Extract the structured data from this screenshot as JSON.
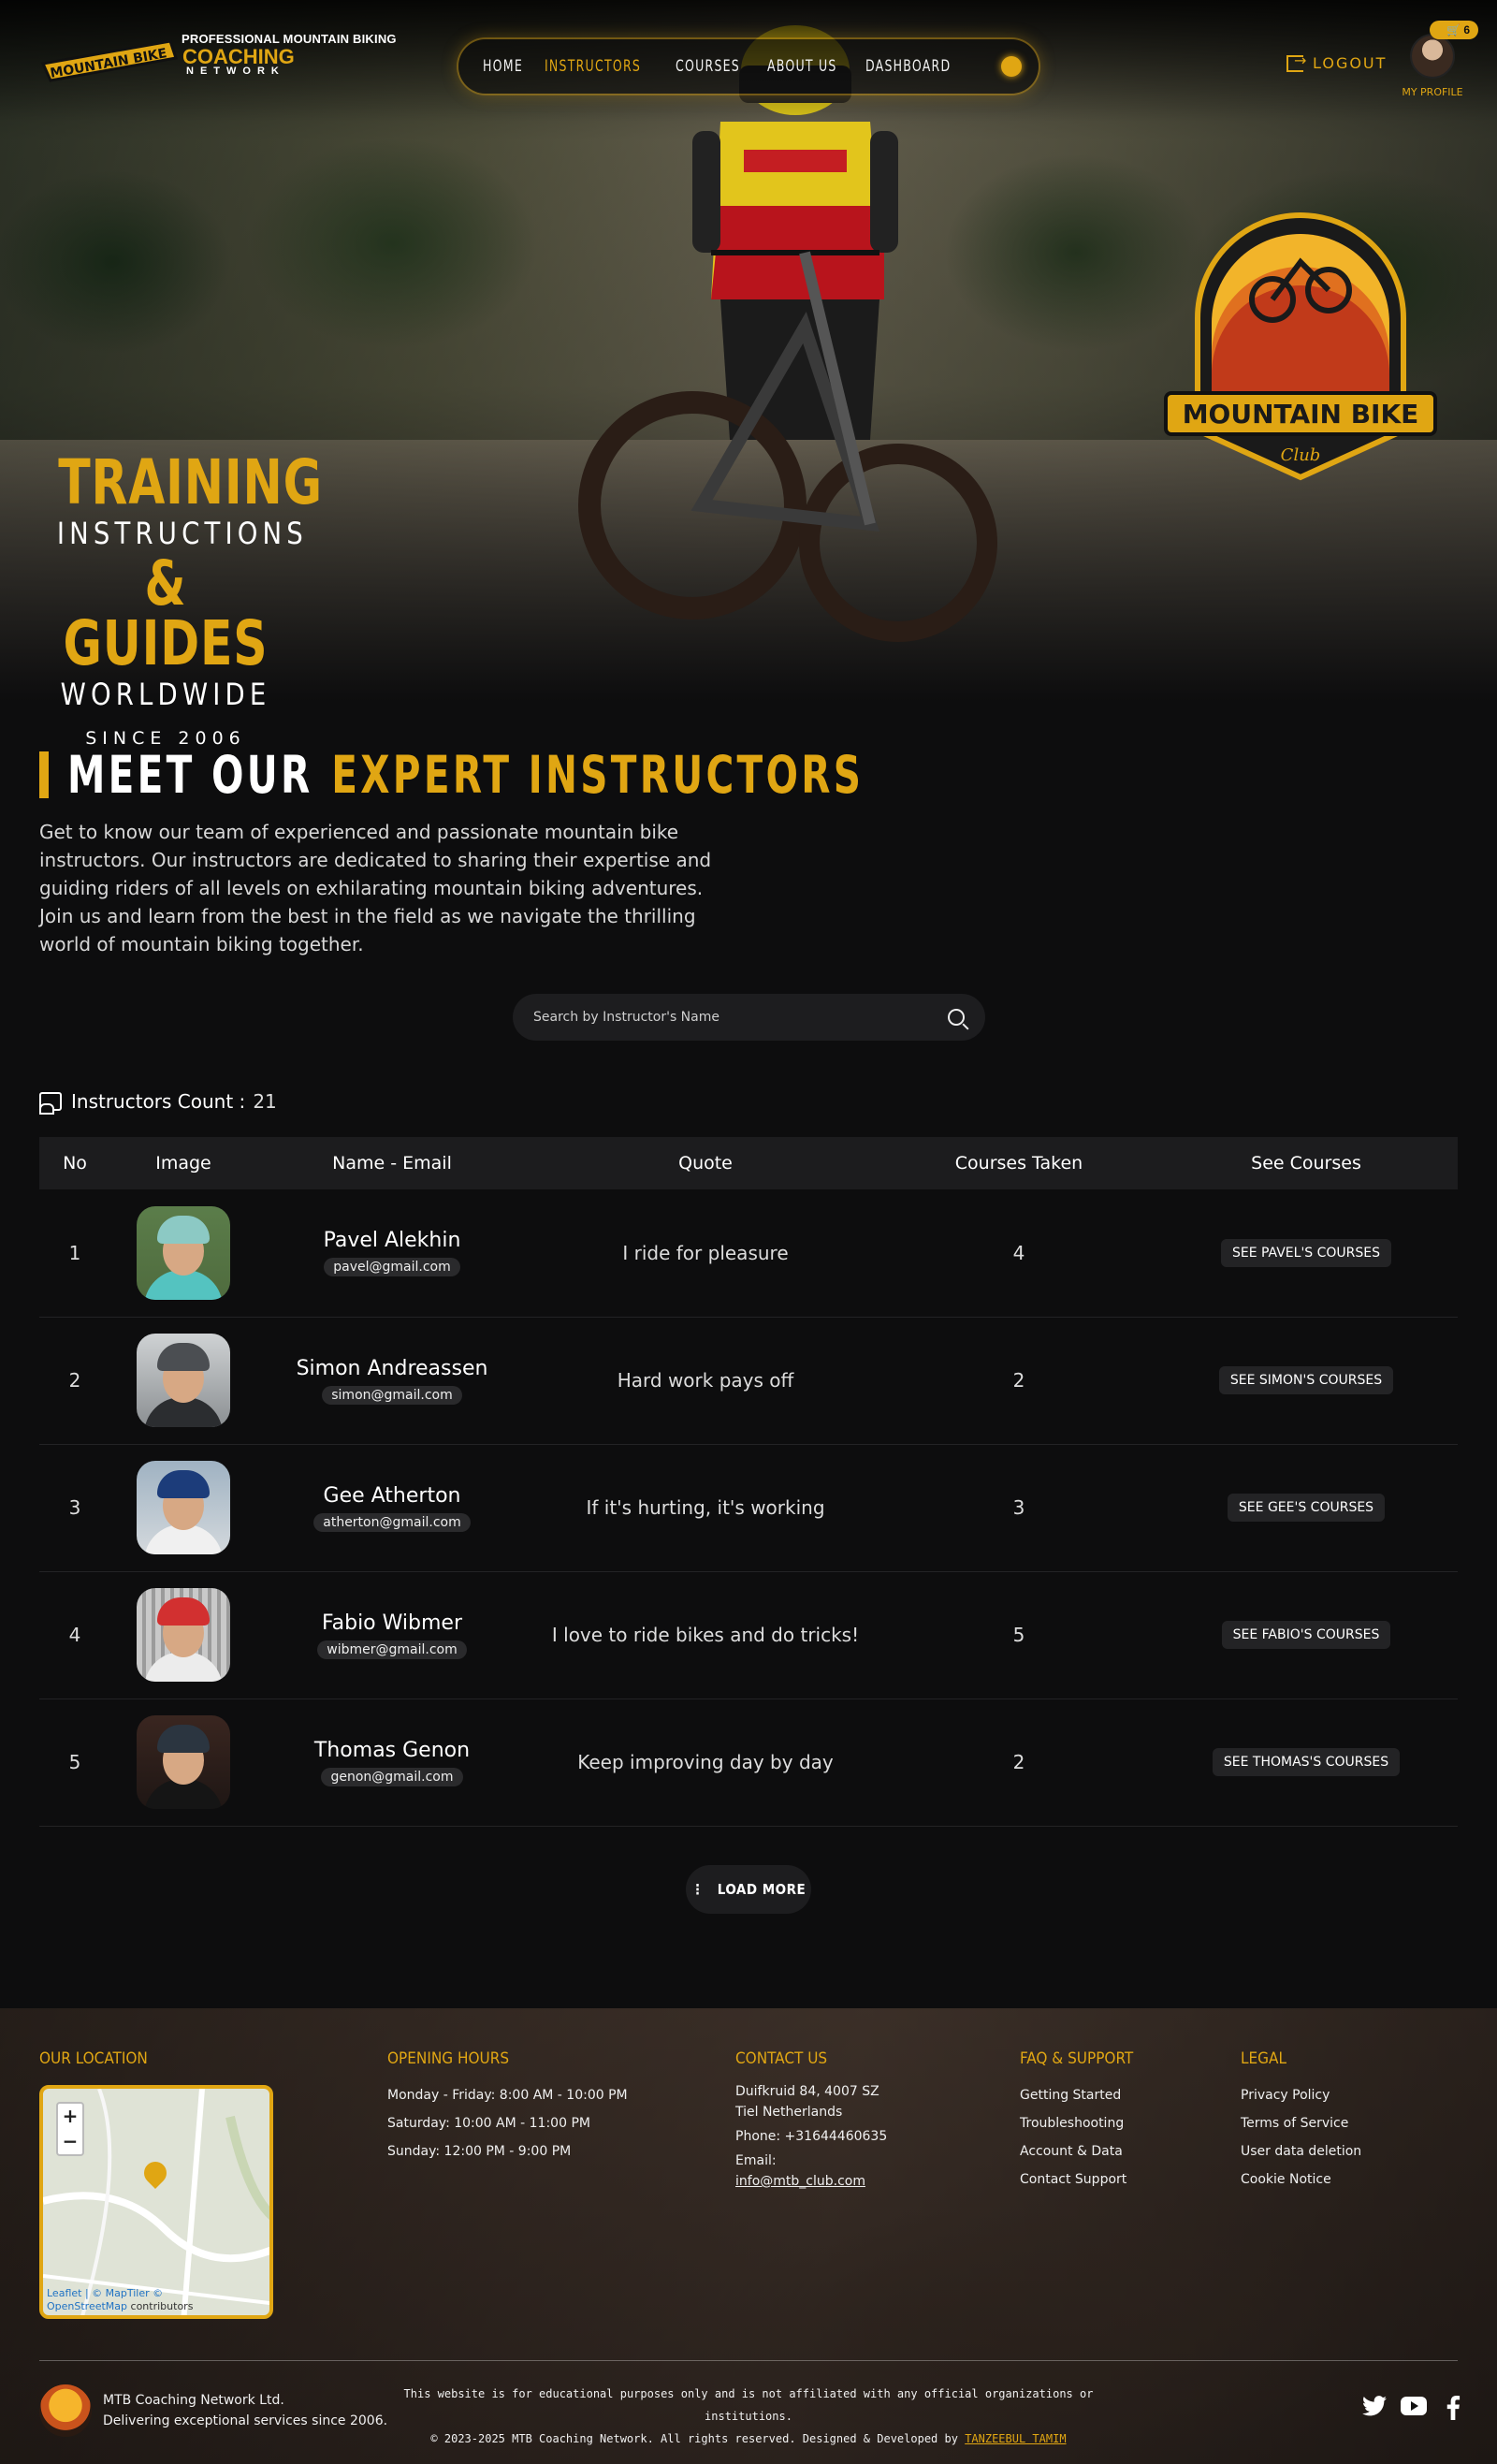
{
  "brand": {
    "line1": "PROFESSIONAL MOUNTAIN BIKING",
    "line2": "COACHING",
    "line3": "NETWORK",
    "badge": "MOUNTAIN BIKE",
    "badge_sub": "Club"
  },
  "nav": {
    "items": [
      "HOME",
      "INSTRUCTORS",
      "COURSES",
      "ABOUT US",
      "DASHBOARD"
    ],
    "active": "INSTRUCTORS",
    "theme_icon": "sun-icon"
  },
  "header": {
    "logout_label": "LOGOUT",
    "cart_count": "6",
    "profile_label": "MY PROFILE"
  },
  "hero": {
    "line1": "TRAINING",
    "line2": "INSTRUCTIONS",
    "line3": "& GUIDES",
    "line4": "WORLDWIDE",
    "since": "SINCE 2006",
    "logo_text": "MOUNTAIN BIKE",
    "logo_sub": "Club"
  },
  "section": {
    "title_white": "MEET OUR",
    "title_yellow": "EXPERT INSTRUCTORS",
    "intro": "Get to know our team of experienced and passionate mountain bike instructors. Our instructors are dedicated to sharing their expertise and guiding riders of all levels on exhilarating mountain biking adventures. Join us and learn from the best in the field as we navigate the thrilling world of mountain biking together."
  },
  "search": {
    "placeholder": "Search by Instructor's Name"
  },
  "count": {
    "label": "Instructors Count :",
    "value": "21"
  },
  "table": {
    "headers": [
      "No",
      "Image",
      "Name - Email",
      "Quote",
      "Courses Taken",
      "See Courses"
    ],
    "rows": [
      {
        "no": "1",
        "name": "Pavel Alekhin",
        "email": "pavel@gmail.com",
        "quote": "I ride for pleasure",
        "courses": "4",
        "button": "SEE PAVEL'S COURSES"
      },
      {
        "no": "2",
        "name": "Simon Andreassen",
        "email": "simon@gmail.com",
        "quote": "Hard work pays off",
        "courses": "2",
        "button": "SEE SIMON'S COURSES"
      },
      {
        "no": "3",
        "name": "Gee Atherton",
        "email": "atherton@gmail.com",
        "quote": "If it's hurting, it's working",
        "courses": "3",
        "button": "SEE GEE'S COURSES"
      },
      {
        "no": "4",
        "name": "Fabio Wibmer",
        "email": "wibmer@gmail.com",
        "quote": "I love to ride bikes and do tricks!",
        "courses": "5",
        "button": "SEE FABIO'S COURSES"
      },
      {
        "no": "5",
        "name": "Thomas Genon",
        "email": "genon@gmail.com",
        "quote": "Keep improving day by day",
        "courses": "2",
        "button": "SEE THOMAS'S COURSES"
      }
    ]
  },
  "load_more": "LOAD MORE",
  "footer": {
    "location_title": "OUR LOCATION",
    "map_attribution_a": "Leaflet | © MapTiler ©",
    "map_attribution_b": "OpenStreetMap",
    "map_attribution_c": "contributors",
    "hours_title": "OPENING HOURS",
    "hours": [
      "Monday - Friday: 8:00 AM - 10:00 PM",
      "Saturday: 10:00 AM - 11:00 PM",
      "Sunday: 12:00 PM - 9:00 PM"
    ],
    "contact_title": "CONTACT US",
    "address": "Duifkruid 84, 4007 SZ Tiel Netherlands",
    "phone": "Phone: +31644460635",
    "email_label": "Email:",
    "email": "info@mtb_club.com",
    "faq_title": "FAQ & SUPPORT",
    "faq": [
      "Getting Started",
      "Troubleshooting",
      "Account & Data",
      "Contact Support"
    ],
    "legal_title": "LEGAL",
    "legal": [
      "Privacy Policy",
      "Terms of Service",
      "User data deletion",
      "Cookie Notice"
    ],
    "company": "MTB Coaching Network Ltd.",
    "tagline": "Delivering exceptional services since 2006.",
    "disclaimer": "This website is for educational purposes only and is not affiliated with any official organizations or institutions.",
    "copyright": "© 2023-2025 MTB Coaching Network. All rights reserved. Designed & Developed by",
    "developer": "TANZEEBUL TAMIM"
  },
  "colors": {
    "accent": "#e0a613",
    "background": "#0d0d0e",
    "table_header": "#1c1c1e"
  }
}
